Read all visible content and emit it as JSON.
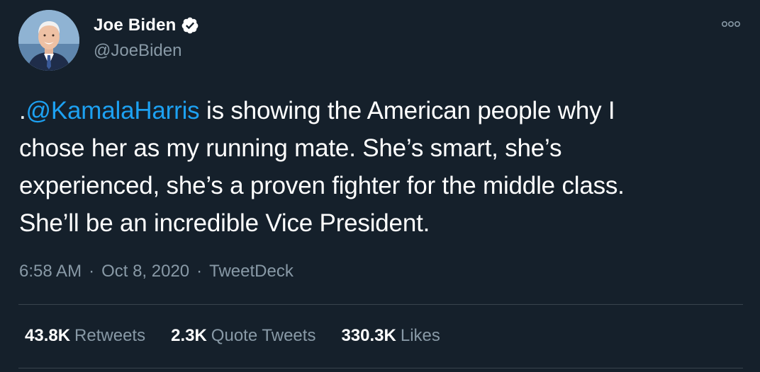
{
  "author": {
    "name": "Joe Biden",
    "handle": "@JoeBiden",
    "verified": true,
    "avatar": "avatar-photo"
  },
  "tweet": {
    "prefix": ".",
    "mention": "@KamalaHarris",
    "line1_rest": " is showing the American people why I",
    "line2": "chose her as my running mate. She’s smart, she’s",
    "line3": "experienced, she’s a proven fighter for the middle class.",
    "line4": "She’ll be an incredible Vice President."
  },
  "meta": {
    "time": "6:58 AM",
    "separator": "·",
    "date": "Oct 8, 2020",
    "source": "TweetDeck"
  },
  "stats": {
    "retweets_count": "43.8K",
    "retweets_label": "Retweets",
    "quotes_count": "2.3K",
    "quotes_label": "Quote Tweets",
    "likes_count": "330.3K",
    "likes_label": "Likes"
  },
  "colors": {
    "background": "#15202b",
    "mention": "#1da1f2",
    "secondary_text": "#8899a6",
    "divider": "#38444d"
  },
  "icons": {
    "verified": "verified-badge-icon",
    "more": "more-options-icon"
  }
}
